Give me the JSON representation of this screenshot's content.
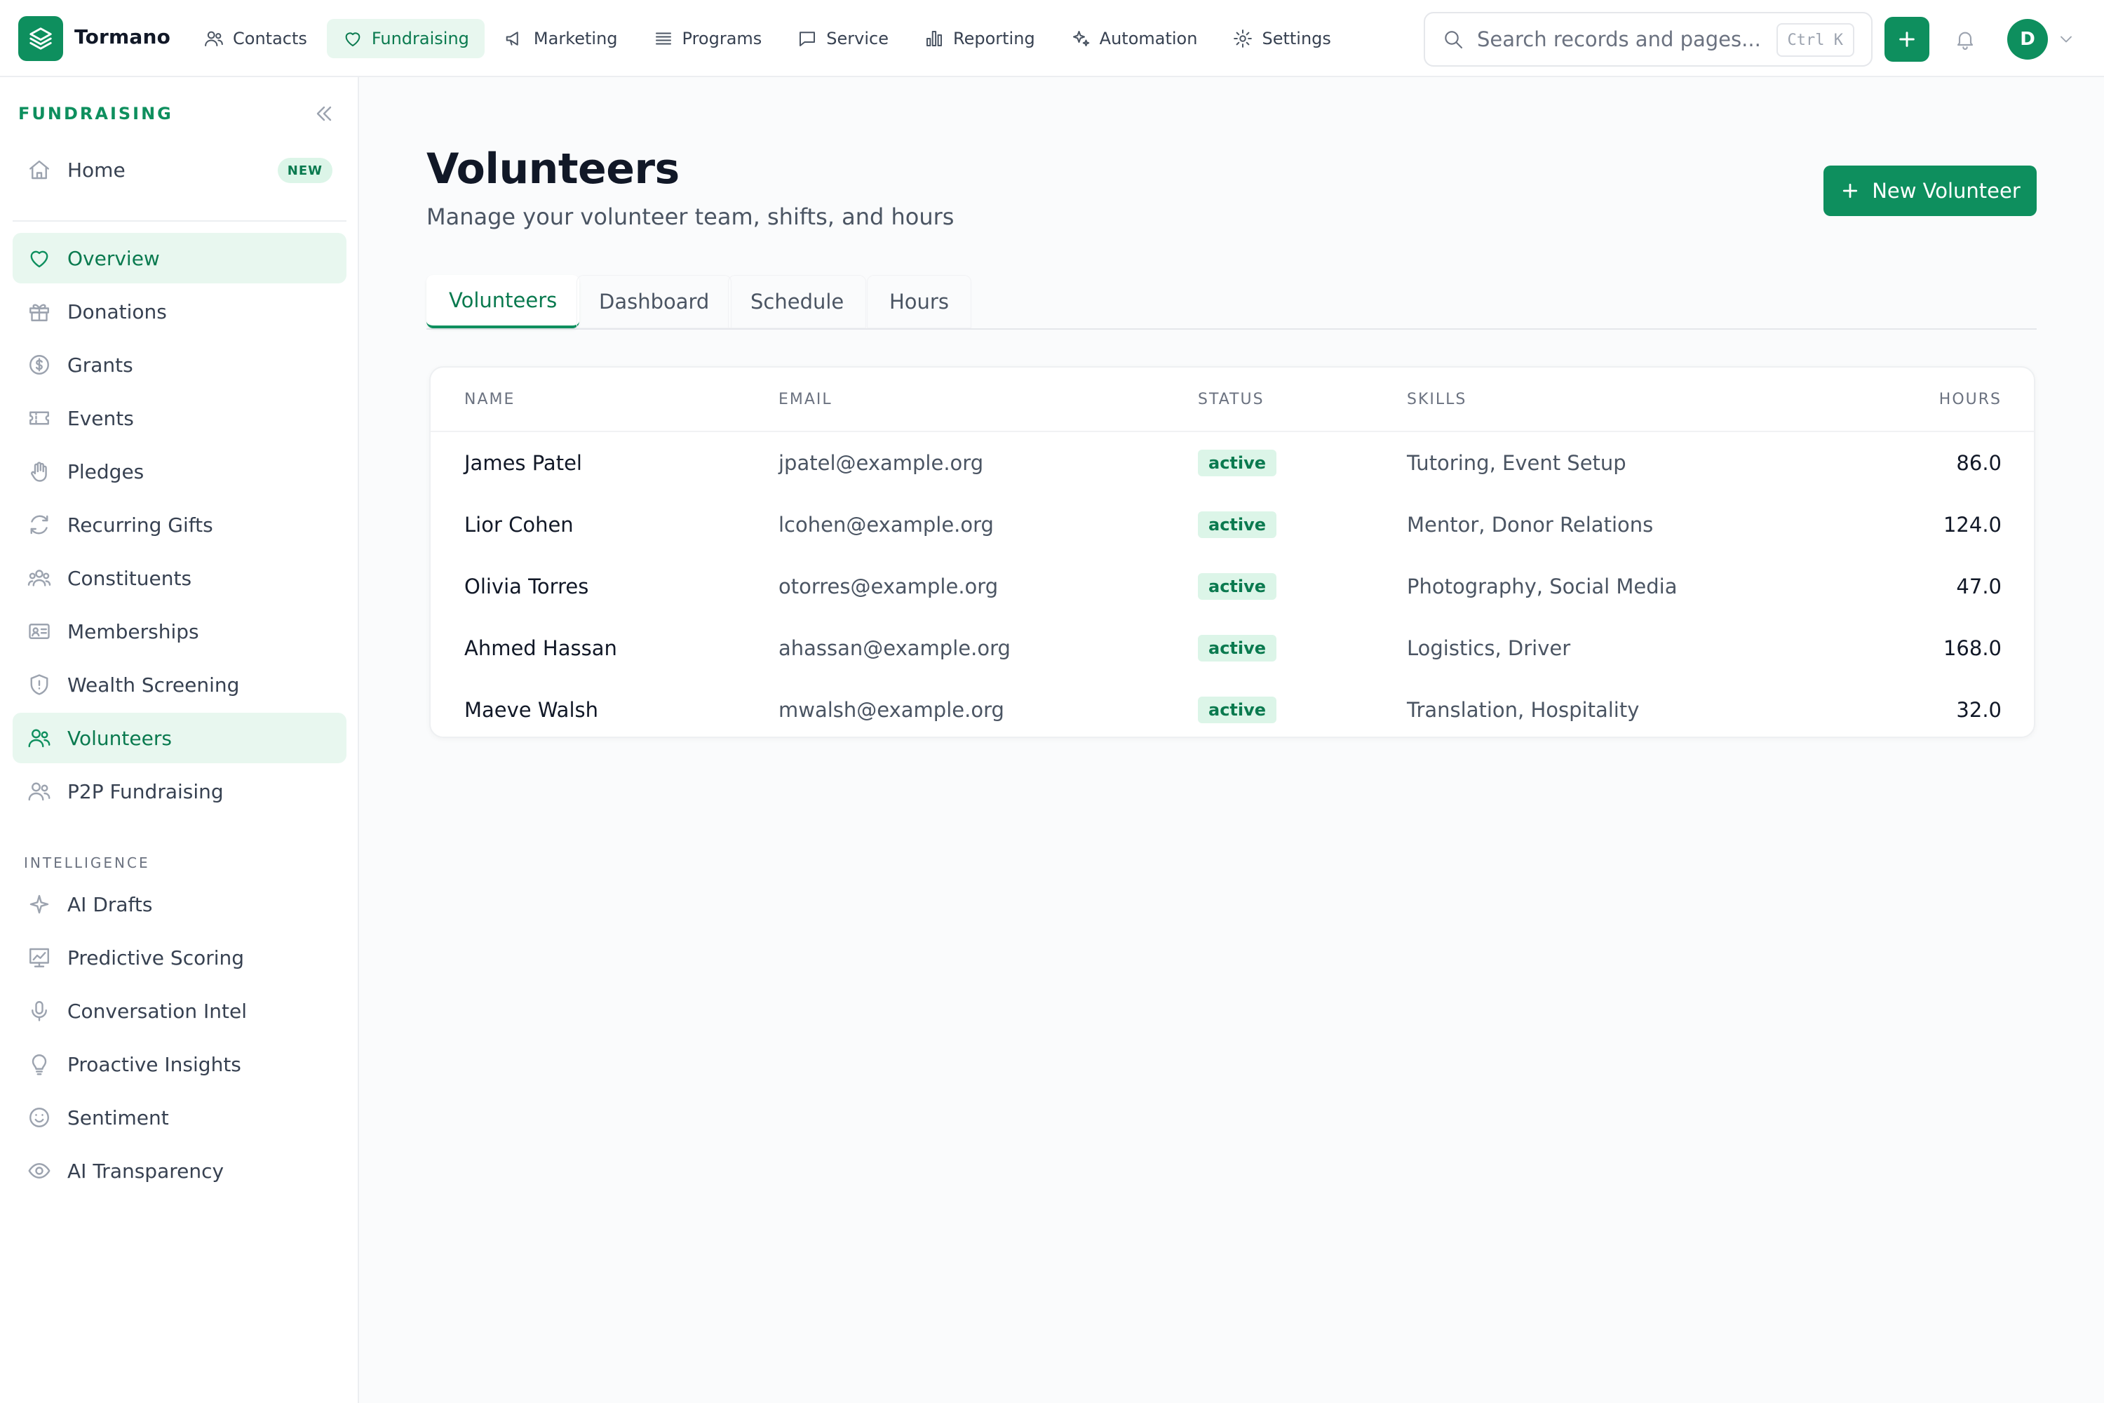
{
  "app": {
    "brand": "Tormano",
    "accent": "#0e8f5e"
  },
  "topnav": {
    "items": [
      {
        "label": "Contacts",
        "icon": "users-icon"
      },
      {
        "label": "Fundraising",
        "icon": "heart-icon",
        "active": true
      },
      {
        "label": "Marketing",
        "icon": "megaphone-icon"
      },
      {
        "label": "Programs",
        "icon": "list-icon"
      },
      {
        "label": "Service",
        "icon": "chat-icon"
      },
      {
        "label": "Reporting",
        "icon": "bar-chart-icon"
      },
      {
        "label": "Automation",
        "icon": "sparkles-icon"
      },
      {
        "label": "Settings",
        "icon": "gear-icon"
      }
    ]
  },
  "search": {
    "placeholder": "Search records and pages...",
    "shortcut": "Ctrl K"
  },
  "user": {
    "initial": "D"
  },
  "sidebar": {
    "title": "FUNDRAISING",
    "home": {
      "label": "Home",
      "badge": "NEW"
    },
    "items": [
      {
        "label": "Overview",
        "icon": "heart-icon",
        "active": true
      },
      {
        "label": "Donations",
        "icon": "gift-icon"
      },
      {
        "label": "Grants",
        "icon": "dollar-circle-icon"
      },
      {
        "label": "Events",
        "icon": "ticket-icon"
      },
      {
        "label": "Pledges",
        "icon": "hand-icon"
      },
      {
        "label": "Recurring Gifts",
        "icon": "refresh-icon"
      },
      {
        "label": "Constituents",
        "icon": "group-icon"
      },
      {
        "label": "Memberships",
        "icon": "id-card-icon"
      },
      {
        "label": "Wealth Screening",
        "icon": "shield-icon"
      },
      {
        "label": "Volunteers",
        "icon": "users-icon",
        "active": true
      },
      {
        "label": "P2P Fundraising",
        "icon": "users-icon"
      }
    ],
    "section_label": "INTELLIGENCE",
    "intel_items": [
      {
        "label": "AI Drafts",
        "icon": "sparkle-icon"
      },
      {
        "label": "Predictive Scoring",
        "icon": "trend-chart-icon"
      },
      {
        "label": "Conversation Intel",
        "icon": "microphone-icon"
      },
      {
        "label": "Proactive Insights",
        "icon": "lightbulb-icon"
      },
      {
        "label": "Sentiment",
        "icon": "smile-icon"
      },
      {
        "label": "AI Transparency",
        "icon": "eye-icon"
      }
    ]
  },
  "page": {
    "title": "Volunteers",
    "subtitle": "Manage your volunteer team, shifts, and hours",
    "new_button": "New Volunteer",
    "tabs": [
      {
        "label": "Volunteers",
        "active": true
      },
      {
        "label": "Dashboard"
      },
      {
        "label": "Schedule"
      },
      {
        "label": "Hours"
      }
    ]
  },
  "table": {
    "columns": [
      "NAME",
      "EMAIL",
      "STATUS",
      "SKILLS",
      "HOURS"
    ],
    "rows": [
      {
        "name": "James Patel",
        "email": "jpatel@example.org",
        "status": "active",
        "skills": "Tutoring, Event Setup",
        "hours": "86.0"
      },
      {
        "name": "Lior Cohen",
        "email": "lcohen@example.org",
        "status": "active",
        "skills": "Mentor, Donor Relations",
        "hours": "124.0"
      },
      {
        "name": "Olivia Torres",
        "email": "otorres@example.org",
        "status": "active",
        "skills": "Photography, Social Media",
        "hours": "47.0"
      },
      {
        "name": "Ahmed Hassan",
        "email": "ahassan@example.org",
        "status": "active",
        "skills": "Logistics, Driver",
        "hours": "168.0"
      },
      {
        "name": "Maeve Walsh",
        "email": "mwalsh@example.org",
        "status": "active",
        "skills": "Translation, Hospitality",
        "hours": "32.0"
      }
    ]
  }
}
